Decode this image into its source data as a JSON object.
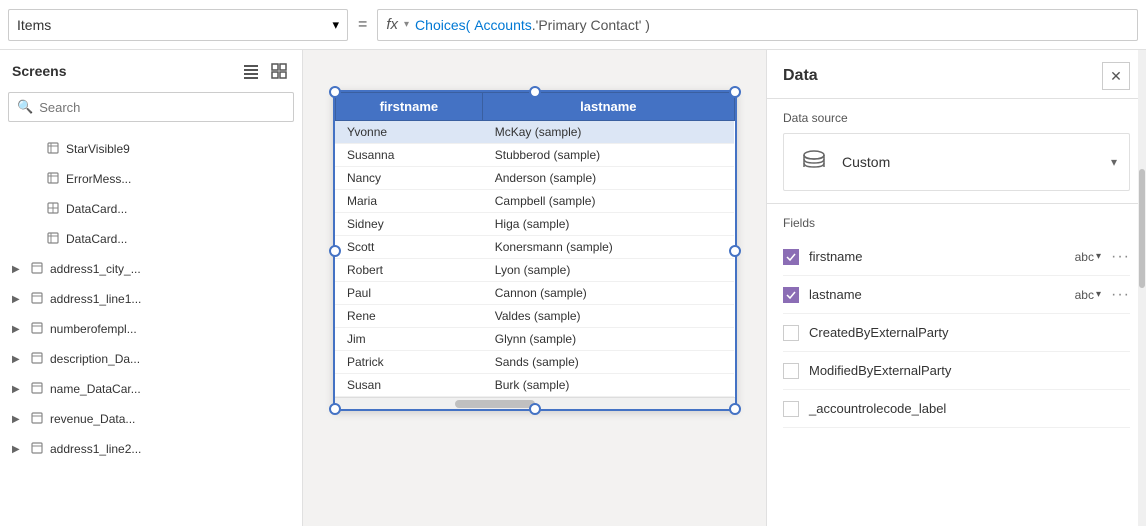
{
  "topbar": {
    "items_label": "Items",
    "equals": "=",
    "fx": "fx",
    "formula": "Choices( Accounts.'Primary Contact' )",
    "formula_choices": "Choices(",
    "formula_accounts": " Accounts.",
    "formula_contact": "'Primary Contact' )"
  },
  "sidebar": {
    "title": "Screens",
    "search_placeholder": "Search",
    "items": [
      {
        "label": "StarVisible9",
        "icon": "✏️",
        "indent": 1
      },
      {
        "label": "ErrorMess...",
        "icon": "✏️",
        "indent": 1
      },
      {
        "label": "DataCard...",
        "icon": "⊞",
        "indent": 1
      },
      {
        "label": "DataCard...",
        "icon": "✏️",
        "indent": 1
      },
      {
        "label": "address1_city_...",
        "icon": "▣",
        "indent": 0,
        "hasChevron": true
      },
      {
        "label": "address1_line1...",
        "icon": "▣",
        "indent": 0,
        "hasChevron": true
      },
      {
        "label": "numberofempl...",
        "icon": "▣",
        "indent": 0,
        "hasChevron": true
      },
      {
        "label": "description_Da...",
        "icon": "▣",
        "indent": 0,
        "hasChevron": true
      },
      {
        "label": "name_DataCar...",
        "icon": "▣",
        "indent": 0,
        "hasChevron": true
      },
      {
        "label": "revenue_Data...",
        "icon": "▣",
        "indent": 0,
        "hasChevron": true
      },
      {
        "label": "address1_line2...",
        "icon": "▣",
        "indent": 0,
        "hasChevron": true
      }
    ]
  },
  "table": {
    "columns": [
      "firstname",
      "lastname"
    ],
    "rows": [
      {
        "firstname": "Yvonne",
        "lastname": "McKay (sample)",
        "selected": true
      },
      {
        "firstname": "Susanna",
        "lastname": "Stubberod (sample)"
      },
      {
        "firstname": "Nancy",
        "lastname": "Anderson (sample)"
      },
      {
        "firstname": "Maria",
        "lastname": "Campbell (sample)"
      },
      {
        "firstname": "Sidney",
        "lastname": "Higa (sample)"
      },
      {
        "firstname": "Scott",
        "lastname": "Konersmann (sample)"
      },
      {
        "firstname": "Robert",
        "lastname": "Lyon (sample)"
      },
      {
        "firstname": "Paul",
        "lastname": "Cannon (sample)"
      },
      {
        "firstname": "Rene",
        "lastname": "Valdes (sample)"
      },
      {
        "firstname": "Jim",
        "lastname": "Glynn (sample)"
      },
      {
        "firstname": "Patrick",
        "lastname": "Sands (sample)"
      },
      {
        "firstname": "Susan",
        "lastname": "Burk (sample)"
      }
    ]
  },
  "right_panel": {
    "title": "Data",
    "close_label": "✕",
    "datasource_label": "Data source",
    "datasource_name": "Custom",
    "fields_label": "Fields",
    "fields": [
      {
        "name": "firstname",
        "type": "abc",
        "checked": true
      },
      {
        "name": "lastname",
        "type": "abc",
        "checked": true
      },
      {
        "name": "CreatedByExternalParty",
        "type": "",
        "checked": false
      },
      {
        "name": "ModifiedByExternalParty",
        "type": "",
        "checked": false
      },
      {
        "name": "_accountrolecode_label",
        "type": "",
        "checked": false
      }
    ]
  }
}
